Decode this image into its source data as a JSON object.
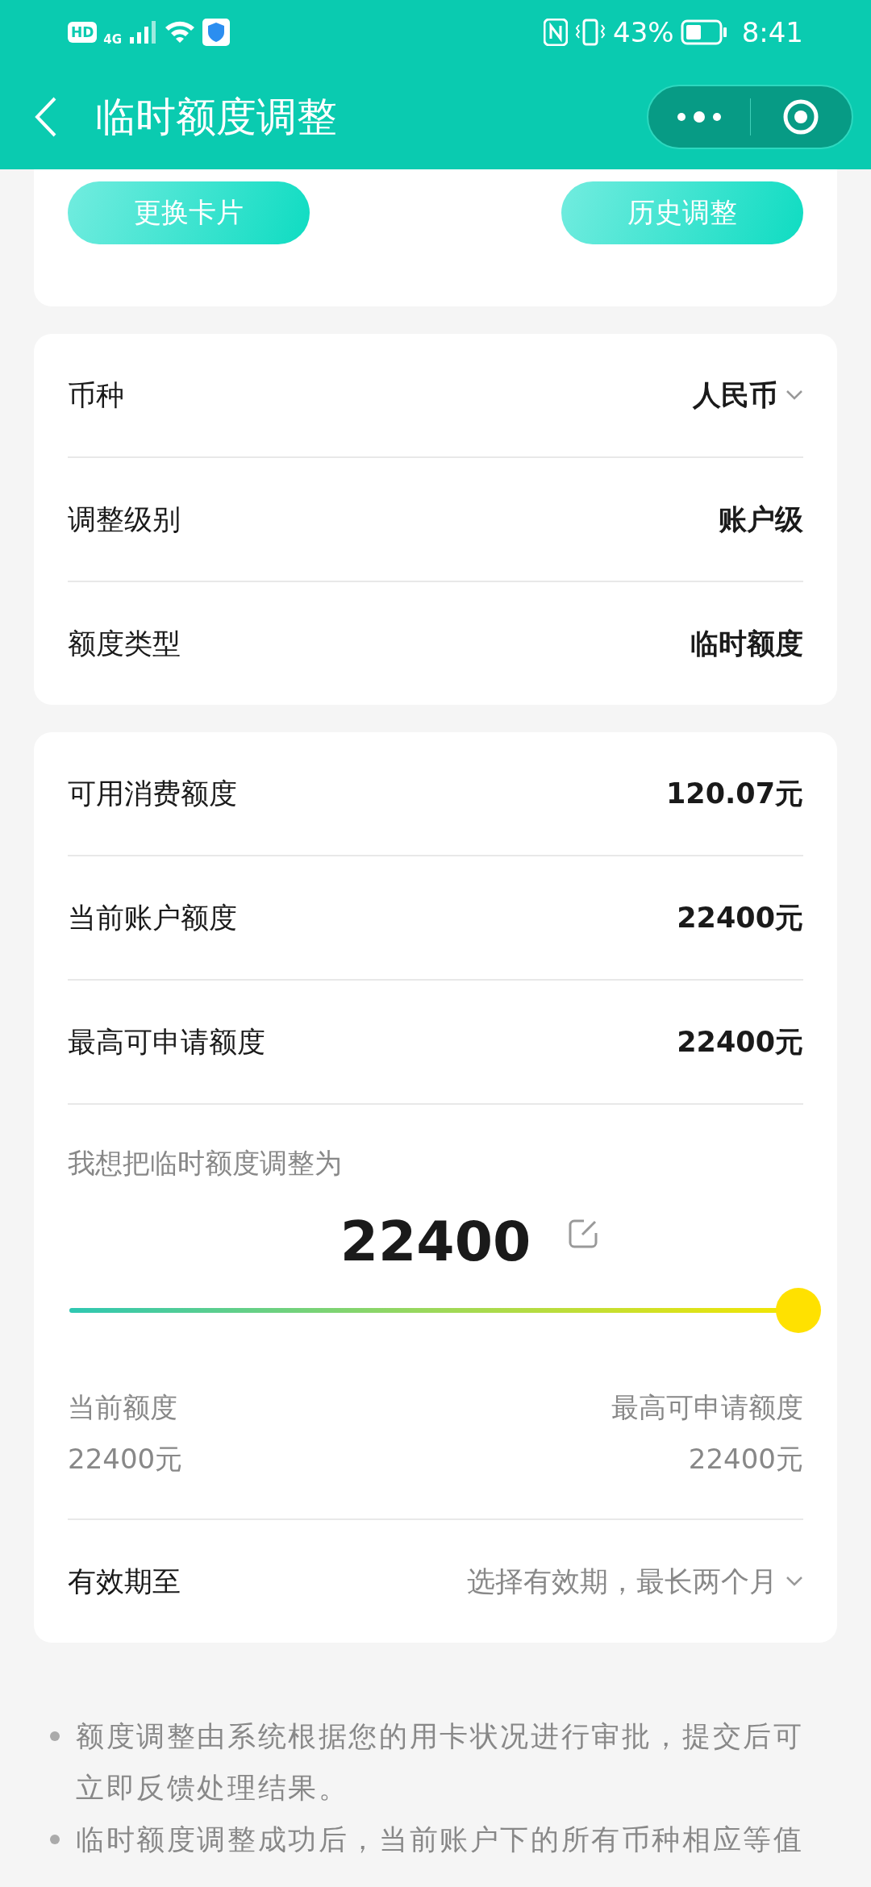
{
  "status_bar": {
    "network_badge": "HD",
    "network_type": "4G",
    "battery": "43%",
    "time": "8:41"
  },
  "header": {
    "title": "临时额度调整"
  },
  "card_actions": [
    {
      "label": "更换卡片"
    },
    {
      "label": "历史调整"
    }
  ],
  "settings": [
    {
      "kind": "select",
      "label": "币种",
      "value": "人民币"
    },
    {
      "kind": "static",
      "label": "调整级别",
      "value": "账户级"
    },
    {
      "kind": "static",
      "label": "额度类型",
      "value": "临时额度"
    }
  ],
  "amounts": [
    {
      "label": "可用消费额度",
      "value": "120.07元"
    },
    {
      "label": "当前账户额度",
      "value": "22400元"
    },
    {
      "label": "最高可申请额度",
      "value": "22400元"
    }
  ],
  "adjust": {
    "prompt": "我想把临时额度调整为",
    "amount": "22400",
    "level": 1,
    "min_label": "当前额度",
    "min_value": "22400元",
    "max_label": "最高可申请额度",
    "max_value": "22400元"
  },
  "validity": {
    "label": "有效期至",
    "placeholder": "选择有效期，最长两个月"
  },
  "notes": [
    "额度调整由系统根据您的用卡状况进行审批，提交后可立即反馈处理结果。",
    "临时额度调整成功后，当前账户下的所有币种相应等值"
  ]
}
